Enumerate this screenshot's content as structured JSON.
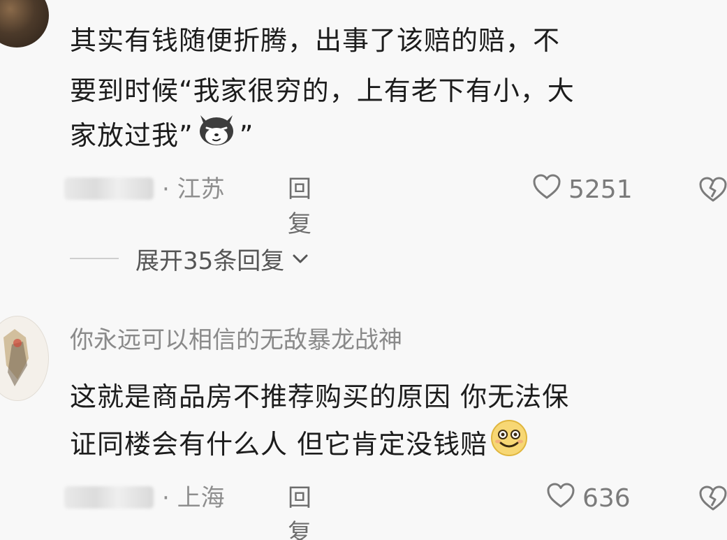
{
  "comments": [
    {
      "lines": [
        "其实有钱随便折腾，出事了该赔的赔，不",
        "要到时候“我家很穷的，上有老下有小，大",
        "家放过我”"
      ],
      "emoji": "dog-smug-emoji",
      "location": "· 江苏",
      "reply_label": "回复",
      "likes": "5251",
      "expand_label": "展开35条回复"
    },
    {
      "username": "你永远可以相信的无敌暴龙战神",
      "lines": [
        "这就是商品房不推荐购买的原因 你无法保",
        "证同楼会有什么人 但它肯定没钱赔"
      ],
      "emoji": "smile-emoji",
      "location": "· 上海",
      "reply_label": "回复",
      "likes": "636"
    }
  ],
  "colors": {
    "background": "#f8f8f8",
    "text": "#1c1c1c",
    "meta": "#8e8e8e"
  }
}
